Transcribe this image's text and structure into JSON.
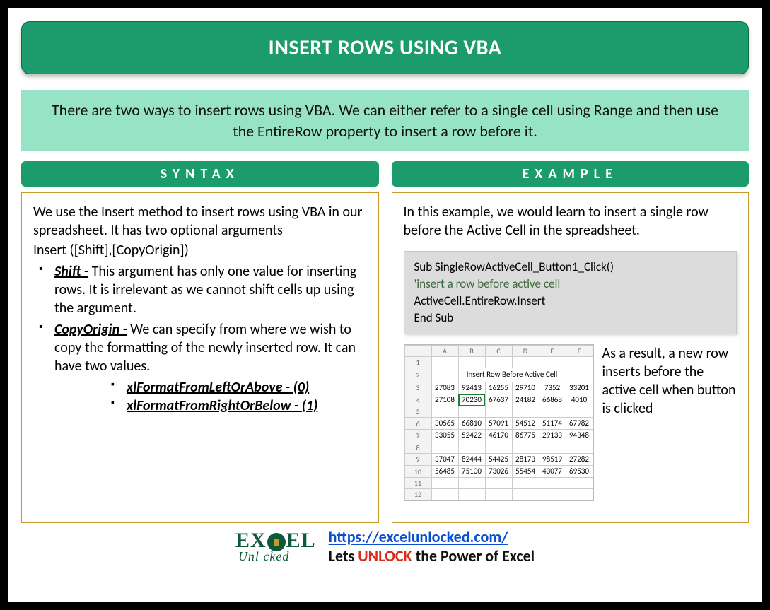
{
  "title": "INSERT ROWS USING VBA",
  "intro": "There are two ways to insert rows using VBA. We can either refer to a single cell using Range and then use the EntireRow property to insert a row before it.",
  "syntax": {
    "heading": "SYNTAX",
    "desc1": "We use the Insert method to insert rows using VBA in our spreadsheet. It has two optional arguments",
    "desc2": "Insert ([Shift],[CopyOrigin])",
    "args": [
      {
        "name": "Shift -",
        "text": " This argument has only one value for inserting rows. It is irrelevant as we cannot shift cells up using the argument."
      },
      {
        "name": "CopyOrigin -",
        "text": " We can specify from where we wish to copy the formatting of the newly inserted row. It can have two values."
      }
    ],
    "consts": [
      "xlFormatFromLeftOrAbove - (0)",
      "xlFormatFromRightOrBelow - (1)"
    ]
  },
  "example": {
    "heading": "EXAMPLE",
    "desc": "In this example, we would learn to insert a single row before the Active Cell in the spreadsheet.",
    "code": {
      "l1": "Sub SingleRowActiveCell_Button1_Click()",
      "l2": "'insert a row before active cell",
      "l3": "ActiveCell.EntireRow.Insert",
      "l4": "End Sub"
    },
    "sheet": {
      "cols": [
        "A",
        "B",
        "C",
        "D",
        "E",
        "F"
      ],
      "button_label": "Insert Row Before Active Cell",
      "rows": [
        {
          "n": 3,
          "v": [
            "27083",
            "92413",
            "16255",
            "29710",
            "7352",
            "33201"
          ]
        },
        {
          "n": 4,
          "v": [
            "27108",
            "70230",
            "67637",
            "24182",
            "66868",
            "4010"
          ]
        },
        {
          "n": 5,
          "v": [
            "",
            "",
            "",
            "",
            "",
            ""
          ]
        },
        {
          "n": 6,
          "v": [
            "30565",
            "66810",
            "57091",
            "54512",
            "51174",
            "67982"
          ]
        },
        {
          "n": 7,
          "v": [
            "33055",
            "52422",
            "46170",
            "86775",
            "29133",
            "94348"
          ]
        },
        {
          "n": 8,
          "v": [
            "",
            "",
            "",
            "",
            "",
            ""
          ]
        },
        {
          "n": 9,
          "v": [
            "37047",
            "82444",
            "54425",
            "28173",
            "98519",
            "27282"
          ]
        },
        {
          "n": 10,
          "v": [
            "56485",
            "75100",
            "73026",
            "55454",
            "43077",
            "69530"
          ]
        },
        {
          "n": 11,
          "v": [
            "",
            "",
            "",
            "",
            "",
            ""
          ]
        },
        {
          "n": 12,
          "v": [
            "",
            "",
            "",
            "",
            "",
            ""
          ]
        }
      ],
      "selected": {
        "row": 4,
        "col": 1
      }
    },
    "result_text": "As a result, a new row inserts before the active cell when button is clicked"
  },
  "footer": {
    "logo_top_left": "EX",
    "logo_top_right": "EL",
    "logo_bottom": "Unl   cked",
    "url": "https://excelunlocked.com/",
    "tag_pre": "Lets ",
    "tag_mid": "UNLOCK",
    "tag_post": " the Power of Excel"
  }
}
